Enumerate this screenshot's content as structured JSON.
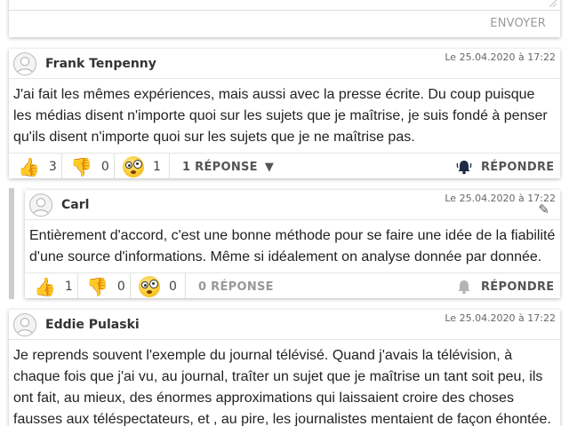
{
  "top": {
    "send_label": "ENVOYER"
  },
  "comments": [
    {
      "author": "Frank Tenpenny",
      "date": "Le 25.04.2020 à 17:22",
      "lines": [
        "J'ai fait les mêmes expériences, mais aussi avec la presse écrite. Du coup puisque",
        "les médias disent n'importe quoi sur les sujets que je maîtrise, je suis fondé à penser",
        "qu'ils disent n'importe quoi sur les sujets que je ne maîtrise pas."
      ],
      "likes": "3",
      "dislikes": "0",
      "wow": "1",
      "replies_label": "1 RÉPONSE",
      "replies_caret": "▼",
      "reply_label": "RÉPONDRE"
    },
    {
      "author": "Carl",
      "date": "Le 25.04.2020 à 17:22",
      "lines": [
        "Entièrement d'accord, c'est une bonne méthode pour se faire une idée de la fiabilité",
        "d'une source d'informations. Même si idéalement on analyse donnée par donnée."
      ],
      "likes": "1",
      "dislikes": "0",
      "wow": "0",
      "replies_label": "0 RÉPONSE",
      "reply_label": "RÉPONDRE"
    },
    {
      "author": "Eddie Pulaski",
      "date": "Le 25.04.2020 à 17:22",
      "lines": [
        "Je reprends souvent l'exemple du journal télévisé. Quand j'avais la télévision, à",
        "chaque fois que j'ai vu, au journal, traîter un sujet que je maîtrise un tant soit peu, ils",
        "ont fait, au mieux, des énormes approximations qui laissaient croire des choses",
        "fausses aux téléspectateurs, et , au pire, les journalistes mentaient de façon éhontée."
      ]
    }
  ],
  "icons": {
    "thumb_up": "👍",
    "thumb_down": "👎",
    "edit": "✎"
  },
  "colors": {
    "accent_yellow": "#f4b400",
    "bell_active": "#1f2a44",
    "bell_inactive": "#b5b5b5"
  }
}
